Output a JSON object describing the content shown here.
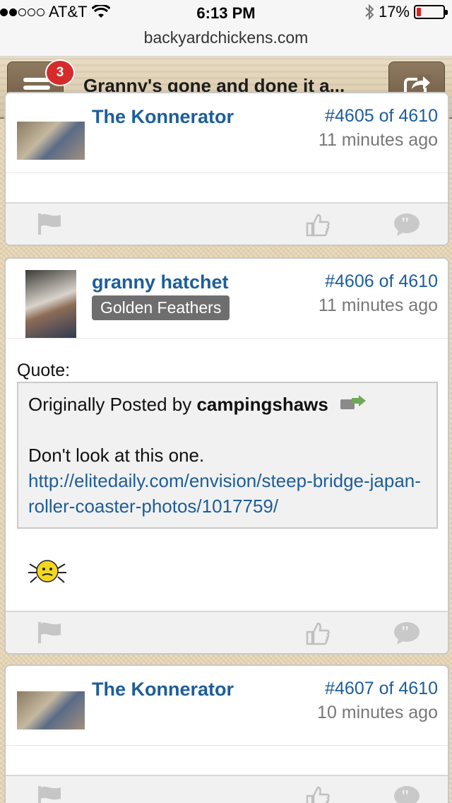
{
  "status_bar": {
    "carrier": "AT&T",
    "time": "6:13 PM",
    "battery": "17%",
    "battery_level": 0.17,
    "battery_color": "#e02020"
  },
  "browser": {
    "url": "backyardchickens.com"
  },
  "header": {
    "title": "Granny's gone and done it a...",
    "notification_count": "3"
  },
  "posts": [
    {
      "author": "The Konnerator",
      "number": "#4605 of 4610",
      "time_ago": "11 minutes ago"
    },
    {
      "author": "granny hatchet",
      "badge": "Golden Feathers",
      "number": "#4606 of 4610",
      "time_ago": "11 minutes ago",
      "quote_label": "Quote:",
      "quote": {
        "prefix": "Originally Posted by ",
        "quoted_author": "campingshaws",
        "text": "Don't look at this one.",
        "link": "http://elitedaily.com/envision/steep-bridge-japan-roller-coaster-photos/1017759/"
      }
    },
    {
      "author": "The Konnerator",
      "number": "#4607 of 4610",
      "time_ago": "10 minutes ago"
    }
  ],
  "colors": {
    "link": "#1d5d9a",
    "badge": "#d62b2b",
    "wood": "#d8c8a8"
  }
}
